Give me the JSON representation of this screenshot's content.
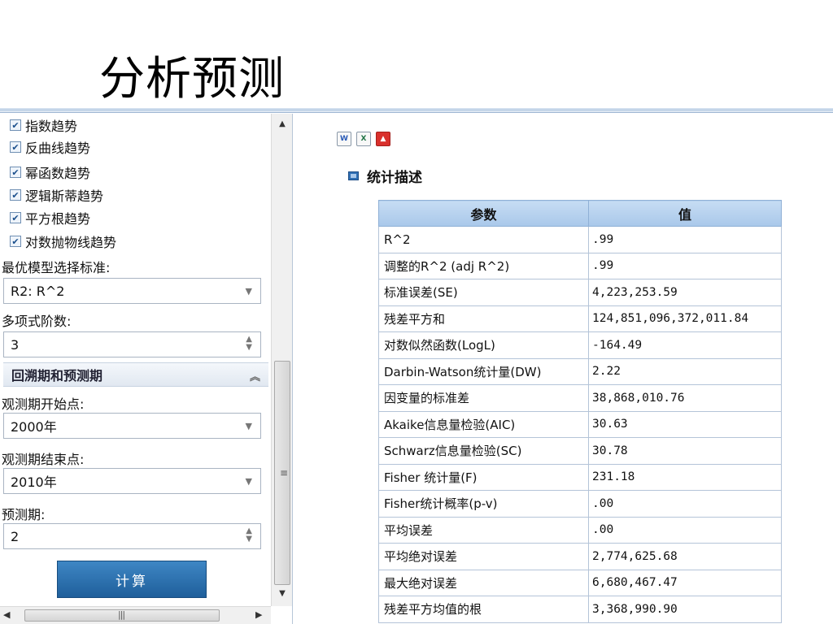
{
  "slide": {
    "title": "分析预测"
  },
  "left_panel": {
    "checkboxes": [
      {
        "label": "指数趋势",
        "checked": true
      },
      {
        "label": "反曲线趋势",
        "checked": true
      },
      {
        "label": "幂函数趋势",
        "checked": true
      },
      {
        "label": "逻辑斯蒂趋势",
        "checked": true
      },
      {
        "label": "平方根趋势",
        "checked": true
      },
      {
        "label": "对数抛物线趋势",
        "checked": true
      }
    ],
    "best_model_label": "最优模型选择标准:",
    "best_model_value": "R2: R^2",
    "poly_order_label": "多项式阶数:",
    "poly_order_value": "3",
    "section_header": "回溯期和预测期",
    "obs_start_label": "观测期开始点:",
    "obs_start_value": "2000年",
    "obs_end_label": "观测期结束点:",
    "obs_end_value": "2010年",
    "forecast_label": "预测期:",
    "forecast_value": "2",
    "calc_button": "计算"
  },
  "right_panel": {
    "toolbar": [
      "word-export-icon",
      "excel-export-icon",
      "pdf-export-icon"
    ],
    "section_title": "统计描述",
    "table": {
      "headers": [
        "参数",
        "值"
      ],
      "rows": [
        [
          "R^2",
          ".99"
        ],
        [
          "调整的R^2 (adj R^2)",
          ".99"
        ],
        [
          "标准误差(SE)",
          "4,223,253.59"
        ],
        [
          "残差平方和",
          "124,851,096,372,011.84"
        ],
        [
          "对数似然函数(LogL)",
          "-164.49"
        ],
        [
          "Darbin-Watson统计量(DW)",
          "2.22"
        ],
        [
          "因变量的标准差",
          "38,868,010.76"
        ],
        [
          "Akaike信息量检验(AIC)",
          "30.63"
        ],
        [
          "Schwarz信息量检验(SC)",
          "30.78"
        ],
        [
          "Fisher 统计量(F)",
          "231.18"
        ],
        [
          "Fisher统计概率(p-v)",
          ".00"
        ],
        [
          "平均误差",
          ".00"
        ],
        [
          "平均绝对误差",
          "2,774,625.68"
        ],
        [
          "最大绝对误差",
          "6,680,467.47"
        ],
        [
          "残差平方均值的根",
          "3,368,990.90"
        ]
      ]
    }
  }
}
